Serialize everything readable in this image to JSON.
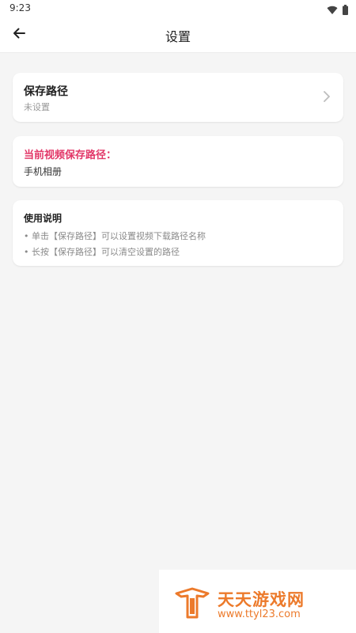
{
  "status_bar": {
    "time": "9:23",
    "icons": [
      "wifi-icon",
      "battery-icon"
    ]
  },
  "header": {
    "title": "设置",
    "back_icon": "arrow-left-icon"
  },
  "save_path": {
    "title": "保存路径",
    "subtitle": "未设置",
    "chevron_icon": "chevron-right-icon"
  },
  "current_path": {
    "label": "当前视频保存路径：",
    "value": "手机相册"
  },
  "usage": {
    "title": "使用说明",
    "lines": [
      "• 单击【保存路径】可以设置视频下载路径名称",
      "• 长按【保存路径】可以清空设置的路径"
    ]
  },
  "watermark": {
    "brand": "天天游戏网",
    "url": "www.ttyl23.com"
  },
  "colors": {
    "accent": "#e23768",
    "background": "#f5f5f5",
    "watermark": "#ec7a2b"
  }
}
